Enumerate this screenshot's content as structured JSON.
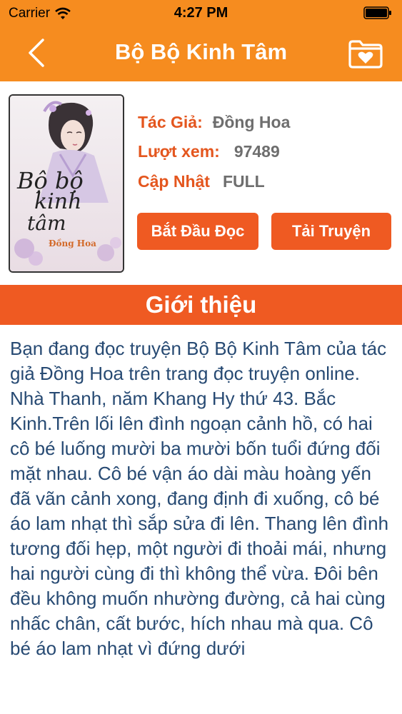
{
  "status_bar": {
    "carrier": "Carrier",
    "time": "4:27 PM",
    "wifi_icon": "wifi-icon",
    "battery_icon": "battery-icon"
  },
  "nav": {
    "title": "Bộ Bộ Kinh Tâm",
    "back_icon": "chevron-left-icon",
    "favorite_icon": "folder-heart-icon",
    "background": "#f68c1f"
  },
  "book": {
    "cover": {
      "title_lines": [
        "Bộ bộ",
        "kinh",
        "tâm"
      ],
      "author": "Đồng Hoa"
    },
    "author_label": "Tác Giả:",
    "author_value": "Đồng Hoa",
    "views_label": "Lượt xem:",
    "views_value": "97489",
    "update_label": "Cập Nhật",
    "update_value": "FULL",
    "read_button": "Bắt Đầu Đọc",
    "download_button": "Tải Truyện",
    "accent": "#ef5a22"
  },
  "intro": {
    "heading": "Giới thiệu",
    "text": "Bạn đang đọc truyện Bộ Bộ Kinh Tâm của tác giả Đồng Hoa trên trang đọc truyện online. Nhà Thanh, năm Khang Hy thứ 43. Bắc Kinh.Trên lối lên đình ngoạn cảnh hồ, có hai cô bé luống mười ba mười bốn tuổi đứng đối mặt nhau. Cô bé vận áo dài màu hoàng yến đã vãn cảnh xong, đang định đi xuống, cô bé áo lam nhạt thì sắp sửa đi lên. Thang lên đình tương đối hẹp, một người đi thoải mái, nhưng hai người cùng đi thì không thể vừa. Đôi bên đều không muốn nhường đường, cả hai cùng nhấc chân, cất bước, hích nhau mà qua. Cô bé áo lam nhạt vì đứng dưới",
    "text_color": "#274a73"
  }
}
